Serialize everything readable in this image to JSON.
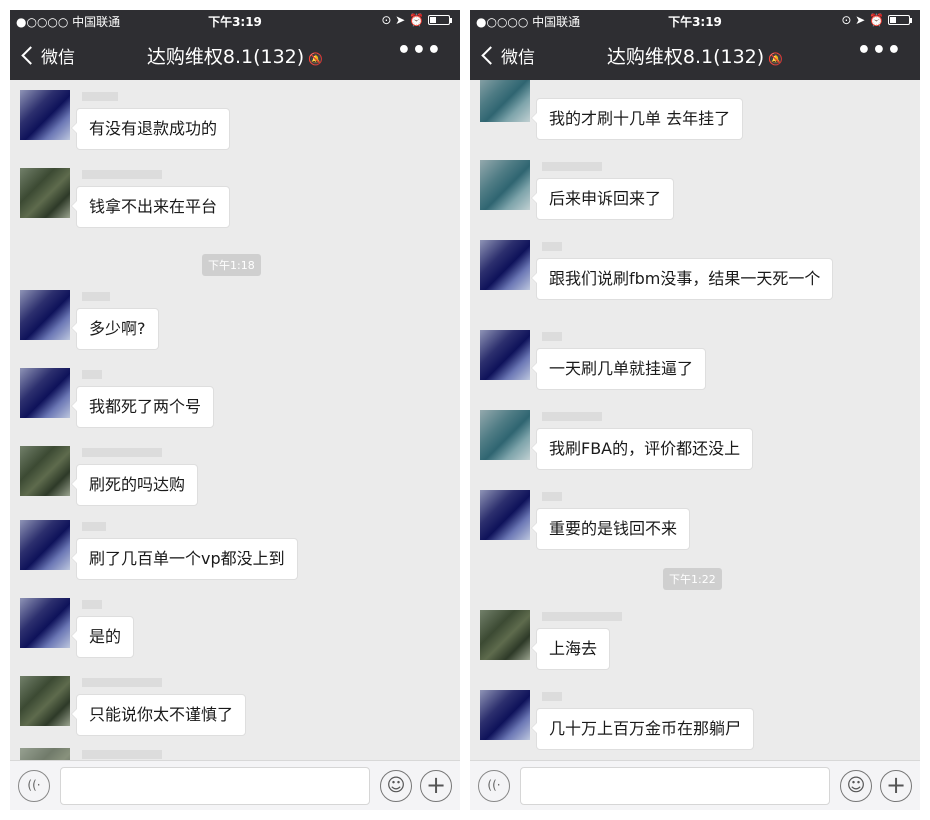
{
  "status_bar": {
    "carrier": "●○○○○ 中国联通",
    "wifi": "wifi-icon",
    "time": "下午3:19",
    "icons": "⊙ ➤ ⏰"
  },
  "nav": {
    "back_label": "微信",
    "title": "达购维权8.1(132)",
    "mute_icon": "mute-bell-icon",
    "more_label": "•••"
  },
  "left_phone": {
    "messages": [
      "有没有退款成功的",
      "钱拿不出来在平台",
      "多少啊?",
      "我都死了两个号",
      "刷死的吗达购",
      "刷了几百单一个vp都没上到",
      "是的",
      "只能说你太不谨慎了"
    ],
    "timestamp": "下午1:18"
  },
  "right_phone": {
    "messages": [
      "我的才刷十几单 去年挂了",
      "后来申诉回来了",
      "跟我们说刷fbm没事，结果一天死一个",
      "一天刷几单就挂逼了",
      "我刷FBA的，评价都还没上",
      "重要的是钱回不来",
      "上海去",
      "几十万上百万金币在那躺尸"
    ],
    "timestamp": "下午1:22"
  },
  "input_bar": {
    "voice_glyph": "((·",
    "emoji_glyph": "☺",
    "plus_glyph": "+"
  }
}
